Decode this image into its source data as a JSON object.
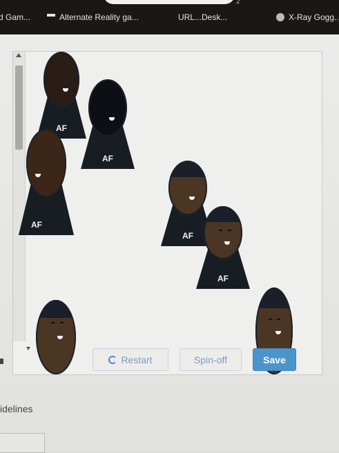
{
  "bookmarks": {
    "items": [
      {
        "label": "d Gam...",
        "icon": "page-icon"
      },
      {
        "label": "Alternate Reality ga...",
        "icon": "grid-icon"
      },
      {
        "label": "URL...Desk...",
        "icon": "page-icon"
      },
      {
        "label": "X-Ray Gogg...",
        "icon": "globe-icon"
      }
    ],
    "top_number": "2"
  },
  "canvas": {
    "avatars": [
      {
        "tag": "AF",
        "style": "mid"
      },
      {
        "tag": "AF",
        "style": "dark"
      },
      {
        "tag": "AF",
        "style": "mid"
      },
      {
        "tag": "AF",
        "style": "mid"
      },
      {
        "tag": "AF",
        "style": "mid"
      },
      {
        "tag": "",
        "style": "mid"
      },
      {
        "tag": "",
        "style": "mid"
      }
    ]
  },
  "buttons": {
    "restart": "Restart",
    "spinoff": "Spin-off",
    "save": "Save"
  },
  "footer": {
    "guidelines": "idelines"
  },
  "colors": {
    "save_bg": "#4c95cc",
    "outline_text": "#7c9cbc",
    "bookmark_bar": "#1b1714"
  }
}
